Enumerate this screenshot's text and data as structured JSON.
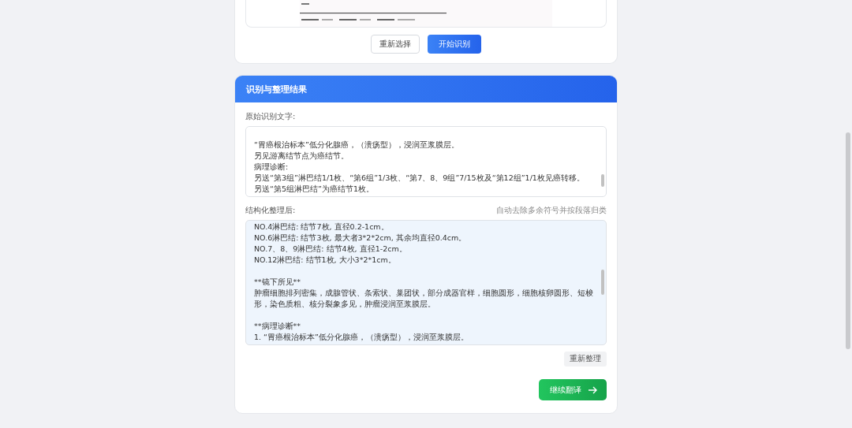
{
  "upload": {
    "buttons": [
      {
        "label": "重新选择",
        "kind": "secondary"
      },
      {
        "label": "开始识别",
        "kind": "primary"
      }
    ]
  },
  "result": {
    "title": "识别与整理结果",
    "raw": {
      "label": "原始识别文字:",
      "paragraphs": [
        [
          "“胃癌根治标本”低分化腺癌，（溃疡型），浸润至浆膜层。",
          "另见游离结节点为癌结节。",
          "病理诊断:",
          "另送“第3组”淋巴结1/1枚、“第6组”1/3枚、“第7、8、9组”7/15枚及“第12组”1/1枚见癌转移。",
          "另送“第5组淋巴结”为癌结节1枚。"
        ]
      ]
    },
    "structured": {
      "label": "结构化整理后:",
      "hint": "自动去除多余符号并按段落归类",
      "paragraphs": [
        [
          "NO.4淋巴结: 结节7枚, 直径0.2-1cm。",
          "NO.6淋巴结: 结节3枚, 最大者3*2*2cm, 其余均直径0.4cm。",
          "NO.7、8、9淋巴结: 结节4枚, 直径1-2cm。",
          "NO.12淋巴结: 结节1枚, 大小3*2*1cm。"
        ],
        [
          "**镜下所见**",
          "肿瘤细胞排列密集，成腺管状、条索状、巢团状，部分成器官样，细胞圆形，细胞核卵圆形、短梭形，染色质粗、核分裂象多见，肿瘤浸润至浆膜层。"
        ],
        [
          "**病理诊断**",
          "1. “胃癌根治标本”低分化腺癌，（溃疡型），浸润至浆膜层。"
        ]
      ]
    },
    "reorganize_button": "重新整理",
    "continue_button": "继续翻译"
  }
}
